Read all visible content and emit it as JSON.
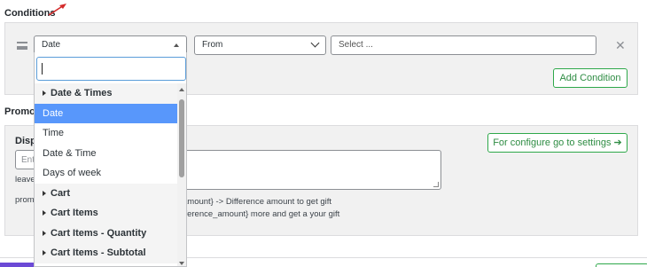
{
  "conditions": {
    "section_title": "Conditions",
    "field_select": "Date",
    "operator_select": "From",
    "value_select_placeholder": "Select ...",
    "add_condition_label": "Add Condition",
    "remove_symbol": "✕"
  },
  "dropdown": {
    "search_value": "",
    "groups": [
      {
        "label": "Date & Times"
      }
    ],
    "items": [
      {
        "label": "Date & Times",
        "type": "group"
      },
      {
        "label": "Date",
        "type": "option",
        "selected": true
      },
      {
        "label": "Time",
        "type": "option"
      },
      {
        "label": "Date & Time",
        "type": "option"
      },
      {
        "label": "Days of week",
        "type": "option"
      },
      {
        "label": "Cart",
        "type": "group"
      },
      {
        "label": "Cart Items",
        "type": "group"
      },
      {
        "label": "Cart Items - Quantity",
        "type": "group"
      },
      {
        "label": "Cart Items - Subtotal",
        "type": "group"
      }
    ]
  },
  "promotion": {
    "section_title_partial": "Promot",
    "display_label_partial": "Displ",
    "input_placeholder_partial": "Ent",
    "leave_text_partial": "leave",
    "prom_text_partial": "prom",
    "configure_button_label": "For configure go to settings ➔",
    "hint_line_1": "amount} -> Difference amount to get gift",
    "hint_line_2": "fference_amount} more and get a your gift"
  },
  "colors": {
    "accent_green": "#2e8c43",
    "selected_blue": "#5897fb",
    "purple": "#6c4ad6"
  }
}
